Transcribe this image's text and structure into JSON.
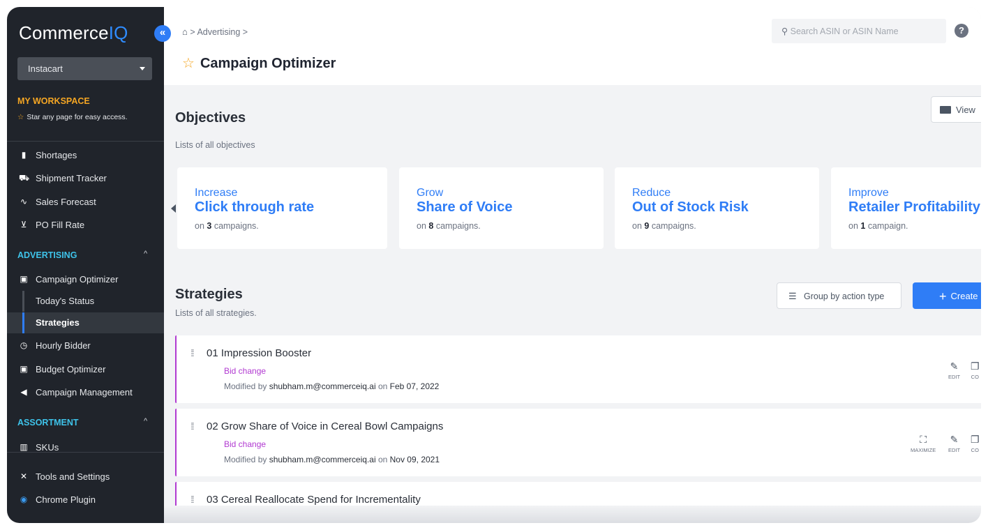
{
  "sidebar": {
    "logo_main": "Commerce",
    "logo_accent": "IQ",
    "collapse_glyph": "«",
    "retailer": "Instacart",
    "workspace_title": "MY WORKSPACE",
    "workspace_sub": "Star any page for easy access.",
    "items_top": [
      {
        "label": "Shortages",
        "icon": "file-icon",
        "glyph": "▮"
      },
      {
        "label": "Shipment Tracker",
        "icon": "truck-icon",
        "glyph": "⛟"
      },
      {
        "label": "Sales Forecast",
        "icon": "trend-icon",
        "glyph": "∿"
      },
      {
        "label": "PO Fill Rate",
        "icon": "cart-icon",
        "glyph": "⊻"
      }
    ],
    "advertising_title": "ADVERTISING",
    "advertising_items": [
      {
        "label": "Campaign Optimizer",
        "icon": "monitor-icon",
        "glyph": "▣"
      }
    ],
    "campaign_subitems": [
      {
        "label": "Today's Status"
      },
      {
        "label": "Strategies"
      }
    ],
    "advertising_items_2": [
      {
        "label": "Hourly Bidder",
        "icon": "clock-icon",
        "glyph": "◷"
      },
      {
        "label": "Budget Optimizer",
        "icon": "budget-icon",
        "glyph": "▣"
      },
      {
        "label": "Campaign Management",
        "icon": "megaphone-icon",
        "glyph": "◀"
      }
    ],
    "assortment_title": "ASSORTMENT",
    "assortment_items": [
      {
        "label": "SKUs",
        "icon": "barcode-icon",
        "glyph": "▥"
      }
    ],
    "bottom_items": [
      {
        "label": "Tools and Settings",
        "icon": "tools-icon",
        "glyph": "✕"
      },
      {
        "label": "Chrome Plugin",
        "icon": "chrome-icon",
        "glyph": "◉"
      }
    ]
  },
  "header": {
    "breadcrumb_section": "Advertising",
    "page_title": "Campaign Optimizer",
    "search_placeholder": "Search ASIN or ASIN Name",
    "help_glyph": "?"
  },
  "objectives": {
    "title": "Objectives",
    "subtitle": "Lists of all objectives",
    "view_label": "View",
    "cards": [
      {
        "verb": "Increase",
        "metric": "Click through rate",
        "prefix": "on ",
        "count": "3",
        "suffix": " campaigns."
      },
      {
        "verb": "Grow",
        "metric": "Share of Voice",
        "prefix": "on ",
        "count": "8",
        "suffix": " campaigns."
      },
      {
        "verb": "Reduce",
        "metric": "Out of Stock Risk",
        "prefix": "on ",
        "count": "9",
        "suffix": " campaigns."
      },
      {
        "verb": "Improve",
        "metric": "Retailer Profitability",
        "prefix": "on ",
        "count": "1",
        "suffix": " campaign."
      }
    ]
  },
  "strategies": {
    "title": "Strategies",
    "subtitle": "Lists of all strategies.",
    "group_label": "Group by action type",
    "create_label": "Create",
    "rows": [
      {
        "name": "01  Impression Booster",
        "action": "Bid change",
        "modified_prefix": "Modified by ",
        "user": "shubham.m@commerceiq.ai",
        "on": " on ",
        "date": "Feb 07, 2022"
      },
      {
        "name": "02  Grow Share of Voice in Cereal Bowl Campaigns",
        "action": "Bid change",
        "modified_prefix": "Modified by ",
        "user": "shubham.m@commerceiq.ai",
        "on": " on ",
        "date": "Nov 09, 2021"
      },
      {
        "name": "03  Cereal Reallocate Spend for Incrementality",
        "action": "",
        "modified_prefix": "",
        "user": "",
        "on": "",
        "date": ""
      }
    ],
    "action_labels": {
      "maximize": "MAXIMIZE",
      "edit": "EDIT",
      "copy": "CO"
    }
  }
}
